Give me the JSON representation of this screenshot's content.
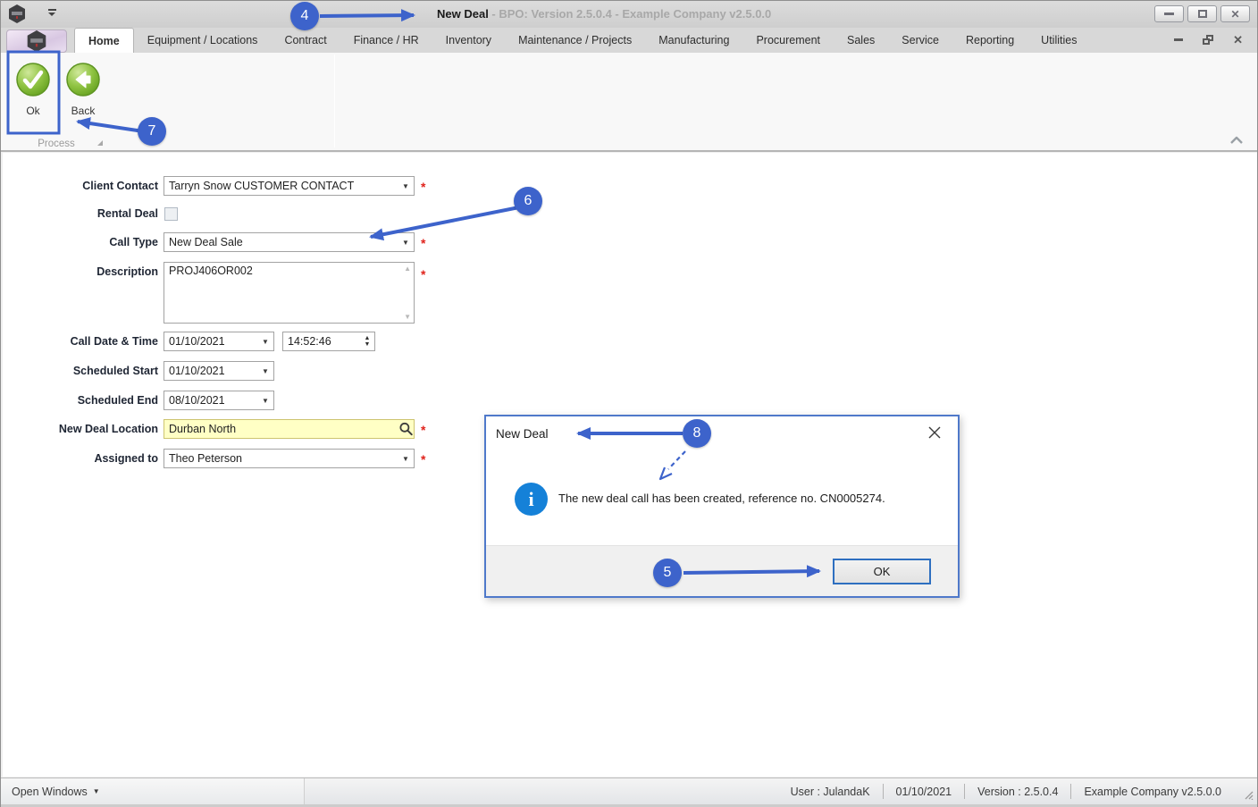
{
  "window": {
    "title_primary": "New Deal",
    "title_secondary": " - BPO: Version 2.5.0.4 - Example Company v2.5.0.0"
  },
  "ribbon": {
    "tabs": [
      "Home",
      "Equipment / Locations",
      "Contract",
      "Finance / HR",
      "Inventory",
      "Maintenance / Projects",
      "Manufacturing",
      "Procurement",
      "Sales",
      "Service",
      "Reporting",
      "Utilities"
    ],
    "active_tab": "Home",
    "ok_label": "Ok",
    "back_label": "Back",
    "group_label": "Process"
  },
  "form": {
    "client_contact": {
      "label": "Client Contact",
      "value": "Tarryn Snow CUSTOMER CONTACT"
    },
    "rental_deal": {
      "label": "Rental Deal",
      "checked": false
    },
    "call_type": {
      "label": "Call Type",
      "value": "New Deal Sale"
    },
    "description": {
      "label": "Description",
      "value": "PROJ406OR002"
    },
    "call_datetime": {
      "label": "Call Date & Time",
      "date": "01/10/2021",
      "time": "14:52:46"
    },
    "scheduled_start": {
      "label": "Scheduled Start",
      "value": "01/10/2021"
    },
    "scheduled_end": {
      "label": "Scheduled End",
      "value": "08/10/2021"
    },
    "new_deal_location": {
      "label": "New Deal Location",
      "value": "Durban North"
    },
    "assigned_to": {
      "label": "Assigned to",
      "value": "Theo Peterson"
    },
    "required_marker": "*"
  },
  "dialog": {
    "title": "New Deal",
    "message": "The new deal call has been created, reference no. CN0005274.",
    "ok_label": "OK",
    "info_glyph": "i"
  },
  "status_bar": {
    "open_windows": "Open Windows",
    "user": "User : JulandaK",
    "date": "01/10/2021",
    "version": "Version : 2.5.0.4",
    "company": "Example Company v2.5.0.0"
  },
  "annotations": {
    "n4": "4",
    "n5": "5",
    "n6": "6",
    "n7": "7",
    "n8": "8"
  },
  "icons": {
    "dropdown": "▼",
    "spin_up": "▲",
    "spin_down": "▼",
    "scroll_up": "▲",
    "scroll_down": "▼",
    "open_windows_caret": "▼"
  },
  "colors": {
    "annotation_blue": "#3d63cb",
    "required_red": "#e0231c",
    "info_icon_blue": "#1581d8",
    "lookup_field_yellow": "#ffffc5",
    "ok_button_accent": "#2e6fc0"
  }
}
